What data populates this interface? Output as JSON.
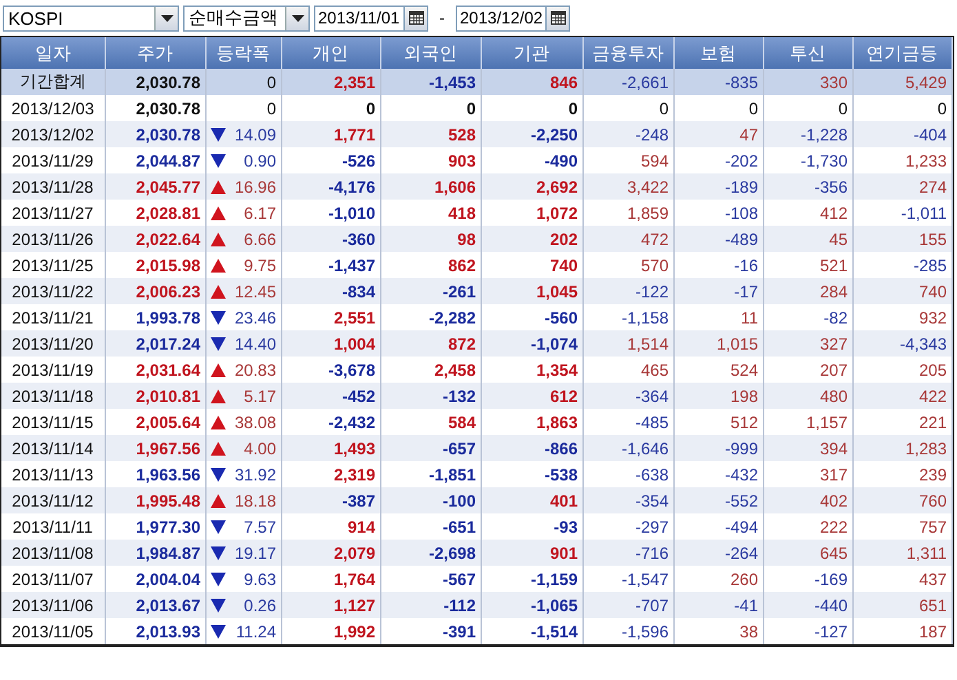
{
  "toolbar": {
    "market": "KOSPI",
    "measure": "순매수금액",
    "date_from": "2013/11/01",
    "separator": "-",
    "date_to": "2013/12/02"
  },
  "table": {
    "columns": [
      "일자",
      "주가",
      "등락폭",
      "개인",
      "외국인",
      "기관",
      "금융투자",
      "보험",
      "투신",
      "연기금등"
    ],
    "rows": [
      {
        "kind": "summary",
        "date": "기간합계",
        "price": "2,030.78",
        "rising": false,
        "falling": false,
        "change": "0",
        "values": [
          "2,351",
          "-1,453",
          "846",
          "-2,661",
          "-835",
          "330",
          "5,429"
        ]
      },
      {
        "kind": "day",
        "date": "2013/12/03",
        "price": "2,030.78",
        "rising": false,
        "falling": false,
        "change": "0",
        "values": [
          "0",
          "0",
          "0",
          "0",
          "0",
          "0",
          "0"
        ]
      },
      {
        "kind": "day",
        "date": "2013/12/02",
        "price": "2,030.78",
        "rising": false,
        "falling": true,
        "change": "14.09",
        "values": [
          "1,771",
          "528",
          "-2,250",
          "-248",
          "47",
          "-1,228",
          "-404"
        ]
      },
      {
        "kind": "day",
        "date": "2013/11/29",
        "price": "2,044.87",
        "rising": false,
        "falling": true,
        "change": "0.90",
        "values": [
          "-526",
          "903",
          "-490",
          "594",
          "-202",
          "-1,730",
          "1,233"
        ]
      },
      {
        "kind": "day",
        "date": "2013/11/28",
        "price": "2,045.77",
        "rising": true,
        "falling": false,
        "change": "16.96",
        "values": [
          "-4,176",
          "1,606",
          "2,692",
          "3,422",
          "-189",
          "-356",
          "274"
        ]
      },
      {
        "kind": "day",
        "date": "2013/11/27",
        "price": "2,028.81",
        "rising": true,
        "falling": false,
        "change": "6.17",
        "values": [
          "-1,010",
          "418",
          "1,072",
          "1,859",
          "-108",
          "412",
          "-1,011"
        ]
      },
      {
        "kind": "day",
        "date": "2013/11/26",
        "price": "2,022.64",
        "rising": true,
        "falling": false,
        "change": "6.66",
        "values": [
          "-360",
          "98",
          "202",
          "472",
          "-489",
          "45",
          "155"
        ]
      },
      {
        "kind": "day",
        "date": "2013/11/25",
        "price": "2,015.98",
        "rising": true,
        "falling": false,
        "change": "9.75",
        "values": [
          "-1,437",
          "862",
          "740",
          "570",
          "-16",
          "521",
          "-285"
        ]
      },
      {
        "kind": "day",
        "date": "2013/11/22",
        "price": "2,006.23",
        "rising": true,
        "falling": false,
        "change": "12.45",
        "values": [
          "-834",
          "-261",
          "1,045",
          "-122",
          "-17",
          "284",
          "740"
        ]
      },
      {
        "kind": "day",
        "date": "2013/11/21",
        "price": "1,993.78",
        "rising": false,
        "falling": true,
        "change": "23.46",
        "values": [
          "2,551",
          "-2,282",
          "-560",
          "-1,158",
          "11",
          "-82",
          "932"
        ]
      },
      {
        "kind": "day",
        "date": "2013/11/20",
        "price": "2,017.24",
        "rising": false,
        "falling": true,
        "change": "14.40",
        "values": [
          "1,004",
          "872",
          "-1,074",
          "1,514",
          "1,015",
          "327",
          "-4,343"
        ]
      },
      {
        "kind": "day",
        "date": "2013/11/19",
        "price": "2,031.64",
        "rising": true,
        "falling": false,
        "change": "20.83",
        "values": [
          "-3,678",
          "2,458",
          "1,354",
          "465",
          "524",
          "207",
          "205"
        ]
      },
      {
        "kind": "day",
        "date": "2013/11/18",
        "price": "2,010.81",
        "rising": true,
        "falling": false,
        "change": "5.17",
        "values": [
          "-452",
          "-132",
          "612",
          "-364",
          "198",
          "480",
          "422"
        ]
      },
      {
        "kind": "day",
        "date": "2013/11/15",
        "price": "2,005.64",
        "rising": true,
        "falling": false,
        "change": "38.08",
        "values": [
          "-2,432",
          "584",
          "1,863",
          "-485",
          "512",
          "1,157",
          "221"
        ]
      },
      {
        "kind": "day",
        "date": "2013/11/14",
        "price": "1,967.56",
        "rising": true,
        "falling": false,
        "change": "4.00",
        "values": [
          "1,493",
          "-657",
          "-866",
          "-1,646",
          "-999",
          "394",
          "1,283"
        ]
      },
      {
        "kind": "day",
        "date": "2013/11/13",
        "price": "1,963.56",
        "rising": false,
        "falling": true,
        "change": "31.92",
        "values": [
          "2,319",
          "-1,851",
          "-538",
          "-638",
          "-432",
          "317",
          "239"
        ]
      },
      {
        "kind": "day",
        "date": "2013/11/12",
        "price": "1,995.48",
        "rising": true,
        "falling": false,
        "change": "18.18",
        "values": [
          "-387",
          "-100",
          "401",
          "-354",
          "-552",
          "402",
          "760"
        ]
      },
      {
        "kind": "day",
        "date": "2013/11/11",
        "price": "1,977.30",
        "rising": false,
        "falling": true,
        "change": "7.57",
        "values": [
          "914",
          "-651",
          "-93",
          "-297",
          "-494",
          "222",
          "757"
        ]
      },
      {
        "kind": "day",
        "date": "2013/11/08",
        "price": "1,984.87",
        "rising": false,
        "falling": true,
        "change": "19.17",
        "values": [
          "2,079",
          "-2,698",
          "901",
          "-716",
          "-264",
          "645",
          "1,311"
        ]
      },
      {
        "kind": "day",
        "date": "2013/11/07",
        "price": "2,004.04",
        "rising": false,
        "falling": true,
        "change": "9.63",
        "values": [
          "1,764",
          "-567",
          "-1,159",
          "-1,547",
          "260",
          "-169",
          "437"
        ]
      },
      {
        "kind": "day",
        "date": "2013/11/06",
        "price": "2,013.67",
        "rising": false,
        "falling": true,
        "change": "0.26",
        "values": [
          "1,127",
          "-112",
          "-1,065",
          "-707",
          "-41",
          "-440",
          "651"
        ]
      },
      {
        "kind": "day",
        "date": "2013/11/05",
        "price": "2,013.93",
        "rising": false,
        "falling": true,
        "change": "11.24",
        "values": [
          "1,992",
          "-391",
          "-1,514",
          "-1,596",
          "38",
          "-127",
          "187"
        ]
      }
    ]
  }
}
